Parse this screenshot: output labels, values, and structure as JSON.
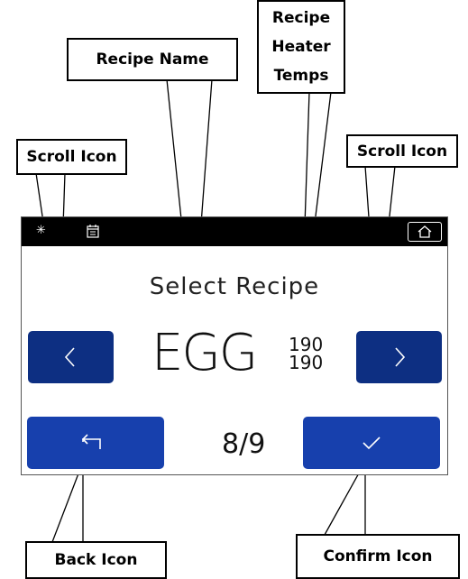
{
  "callouts": {
    "recipe_name": "Recipe Name",
    "recipe_heater_temps_1": "Recipe",
    "recipe_heater_temps_2": "Heater",
    "recipe_heater_temps_3": "Temps",
    "scroll_left": "Scroll Icon",
    "scroll_right": "Scroll Icon",
    "back_icon": "Back Icon",
    "confirm_icon": "Confirm Icon"
  },
  "screen": {
    "title": "Select Recipe",
    "recipe_name": "EGG",
    "temp_1": "190",
    "temp_2": "190",
    "page_indicator": "8/9"
  },
  "colors": {
    "nav_button": "#0d2f82",
    "action_button": "#1740ad",
    "topbar": "#000000"
  },
  "icons": [
    "sun-icon",
    "calendar-icon",
    "home-icon",
    "chevron-left-icon",
    "chevron-right-icon",
    "back-arrow-icon",
    "checkmark-icon"
  ]
}
